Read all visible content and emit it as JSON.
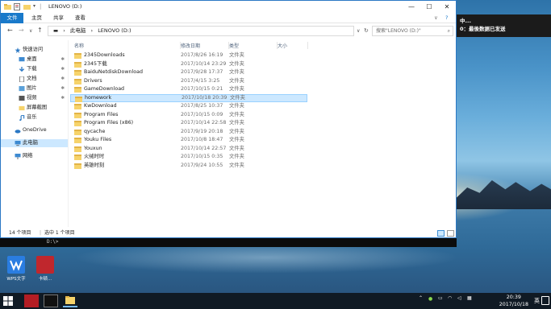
{
  "window": {
    "title": "LENOVO (D:)",
    "ribbon_tabs": [
      "文件",
      "主页",
      "共享",
      "查看"
    ],
    "controls": {
      "minimize": "—",
      "maximize": "☐",
      "close": "✕",
      "help": "?"
    }
  },
  "nav": {
    "back": "←",
    "forward": "→",
    "up": "↑",
    "recent": "∨",
    "breadcrumb": [
      "此电脑",
      "LENOVO (D:)"
    ],
    "refresh": "↻",
    "search_placeholder": "搜索\"LENOVO (D:)\""
  },
  "sidebar": {
    "items": [
      {
        "label": "快速访问",
        "icon": "star-icon",
        "pinned": false
      },
      {
        "label": "桌面",
        "icon": "desktop-icon",
        "pinned": true
      },
      {
        "label": "下载",
        "icon": "download-icon",
        "pinned": true
      },
      {
        "label": "文档",
        "icon": "document-icon",
        "pinned": true
      },
      {
        "label": "图片",
        "icon": "picture-icon",
        "pinned": true
      },
      {
        "label": "视频",
        "icon": "video-icon",
        "pinned": true
      },
      {
        "label": "屏幕截图",
        "icon": "folder-icon",
        "pinned": false
      },
      {
        "label": "音乐",
        "icon": "music-icon",
        "pinned": false
      },
      {
        "label": "OneDrive",
        "icon": "cloud-icon",
        "pinned": false
      },
      {
        "label": "此电脑",
        "icon": "computer-icon",
        "pinned": false
      },
      {
        "label": "网络",
        "icon": "network-icon",
        "pinned": false
      }
    ],
    "pin_glyph": "✱"
  },
  "columns": [
    "名称",
    "修改日期",
    "类型",
    "大小"
  ],
  "files": [
    {
      "name": "2345Downloads",
      "date": "2017/8/26 16:19",
      "type": "文件夹"
    },
    {
      "name": "2345下载",
      "date": "2017/10/14 23:29",
      "type": "文件夹"
    },
    {
      "name": "BaiduNetdiskDownload",
      "date": "2017/9/28 17:37",
      "type": "文件夹"
    },
    {
      "name": "Drivers",
      "date": "2017/4/15 3:25",
      "type": "文件夹"
    },
    {
      "name": "GameDownload",
      "date": "2017/10/15 0:21",
      "type": "文件夹"
    },
    {
      "name": "homework",
      "date": "2017/10/18 20:39",
      "type": "文件夹"
    },
    {
      "name": "KwDownload",
      "date": "2017/8/25 10:37",
      "type": "文件夹"
    },
    {
      "name": "Program Files",
      "date": "2017/10/15 0:09",
      "type": "文件夹"
    },
    {
      "name": "Program Files (x86)",
      "date": "2017/10/14 22:58",
      "type": "文件夹"
    },
    {
      "name": "qycache",
      "date": "2017/9/19 20:18",
      "type": "文件夹"
    },
    {
      "name": "Youku Files",
      "date": "2017/10/8 18:47",
      "type": "文件夹"
    },
    {
      "name": "Youxun",
      "date": "2017/10/14 22:57",
      "type": "文件夹"
    },
    {
      "name": "火绒时时",
      "date": "2017/10/15 0:35",
      "type": "文件夹"
    },
    {
      "name": "英雄时刻",
      "date": "2017/9/24 10:55",
      "type": "文件夹"
    }
  ],
  "selected_index": 5,
  "status": {
    "count": "14 个项目",
    "selection": "选中 1 个项目"
  },
  "cmd_line": "D:\\>",
  "notification": {
    "line1": "中...",
    "line2": "0：最後数据已发送"
  },
  "desktop_icons": [
    {
      "label": "WPS文字",
      "color": "#2a7de1"
    },
    {
      "label": "卡顿...",
      "color": "#c0272d"
    }
  ],
  "taskbar": {
    "time": "20:39",
    "date": "2017/10/18",
    "ime": "英"
  },
  "colors": {
    "accent": "#1979ca",
    "selection": "#cce8ff",
    "folder": "#f6d36b"
  }
}
